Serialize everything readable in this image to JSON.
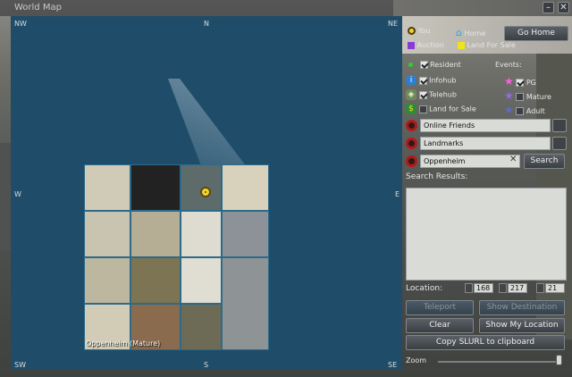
{
  "window": {
    "title": "World Map"
  },
  "compass": {
    "nw": "NW",
    "n": "N",
    "ne": "NE",
    "w": "W",
    "e": "E",
    "sw": "SW",
    "s": "S",
    "se": "SE"
  },
  "map": {
    "region_label": "Oppenheim (Mature)"
  },
  "legend": {
    "you": "You",
    "home": "Home",
    "auction": "Auction",
    "land_for_sale": "Land For Sale",
    "go_home": "Go Home"
  },
  "filters": {
    "resident": {
      "label": "Resident",
      "checked": true
    },
    "infohub": {
      "label": "Infohub",
      "checked": true
    },
    "telehub": {
      "label": "Telehub",
      "checked": true
    },
    "land_for_sale": {
      "label": "Land for Sale",
      "checked": false
    }
  },
  "events": {
    "heading": "Events:",
    "pg": {
      "label": "PG",
      "checked": true
    },
    "mature": {
      "label": "Mature",
      "checked": false
    },
    "adult": {
      "label": "Adult",
      "checked": false
    }
  },
  "online_friends": {
    "value": "Online Friends"
  },
  "landmarks": {
    "value": "Landmarks"
  },
  "search": {
    "value": "Oppenheim",
    "button": "Search",
    "results_heading": "Search Results:"
  },
  "location": {
    "label": "Location:",
    "x": "168",
    "y": "217",
    "z": "21"
  },
  "buttons": {
    "teleport": "Teleport",
    "show_destination": "Show Destination",
    "clear": "Clear",
    "show_my_location": "Show My Location",
    "copy_slurl": "Copy SLURL to clipboard"
  },
  "zoom": {
    "label": "Zoom",
    "level": 0.97
  },
  "colors": {
    "map_water": "#1f4d69",
    "you_marker": "#f4d230",
    "auction": "#8a3bd6",
    "land_for_sale": "#f2e21a",
    "home": "#2fa6e8"
  }
}
